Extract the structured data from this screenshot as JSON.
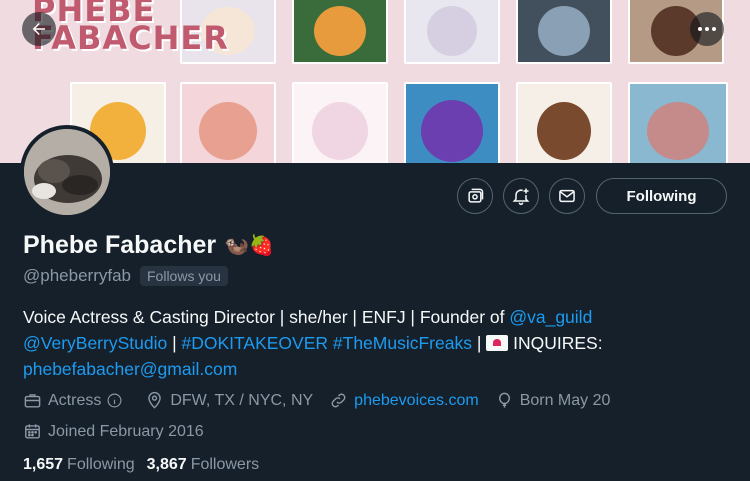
{
  "banner": {
    "logo_line1": "PHEBE",
    "logo_line2": "FABACHER"
  },
  "actions": {
    "following_label": "Following"
  },
  "profile": {
    "name": "Phebe Fabacher",
    "name_emoji": "🦦🍓",
    "handle": "@pheberryfab",
    "follows_you": "Follows you",
    "bio": {
      "text1": "Voice Actress & Casting Director | she/her | ENFJ | Founder of ",
      "link1": "@va_guild",
      "link2": "@VeryBerryStudio",
      "sep1": " | ",
      "link3": "#DOKITAKEOVER",
      "sep2": " ",
      "link4": "#TheMusicFreaks",
      "text2": " | ",
      "text3": " INQUIRES:",
      "link5": "phebefabacher@gmail.com"
    },
    "meta": {
      "category": "Actress",
      "location": "DFW, TX / NYC, NY",
      "website": "phebevoices.com",
      "birthday": "Born May 20",
      "joined": "Joined February 2016"
    },
    "stats": {
      "following_count": "1,657",
      "following_label": "Following",
      "followers_count": "3,867",
      "followers_label": "Followers"
    }
  }
}
